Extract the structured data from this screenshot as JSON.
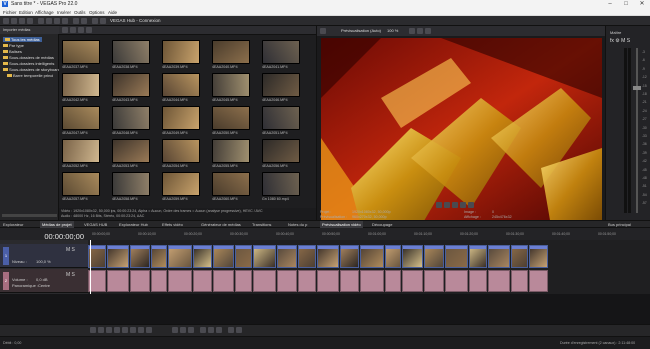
{
  "window": {
    "title": "Sans titre * - VEGAS Pro 22.0"
  },
  "menu": [
    "Fichier",
    "Edition",
    "Affichage",
    "Insérer",
    "Outils",
    "Options",
    "Aide"
  ],
  "toolbar": {
    "hub_connection": "VEGAS Hub - Connexion"
  },
  "explorer": {
    "import_label": "Importer médias",
    "tree": [
      "Tous les médias",
      "Par type",
      "Balises",
      "Sous-dossiers de médias",
      "Sous-dossiers intelligents",
      "Sous-dossiers de storyboard",
      "Barre temporelle princi"
    ]
  },
  "media": {
    "files": [
      "4EAA2037.MP4",
      "4EAA2038.MP4",
      "4EAA2039.MP4",
      "4EAA2040.MP4",
      "4EAA2041.MP4",
      "4EAA2042.MP4",
      "4EAA2043.MP4",
      "4EAA2044.MP4",
      "4EAA2045.MP4",
      "4EAA2046.MP4",
      "4EAA2047.MP4",
      "4EAA2048.MP4",
      "4EAA2049.MP4",
      "4EAA2050.MP4",
      "4EAA2051.MP4",
      "4EAA2052.MP4",
      "4EAA2053.MP4",
      "4EAA2054.MP4",
      "4EAA2055.MP4",
      "4EAA2056.MP4",
      "4EAA2057.MP4",
      "4EAA2058.MP4",
      "4EAA2059.MP4",
      "4EAA2060.MP4",
      "Gn 1080 60.mp4"
    ],
    "info_line1": "Vidéo : 1920x1080x32, 50,000 ips, 00:00:23:24, Alpha = Aucun, Ordre des trames = Aucun (analyse progressive), HEVC / AVC",
    "info_line2": "Audio : 48000 Hz, 16 Bits, Stéréo, 00:00:23:24, AAC"
  },
  "preview": {
    "mode": "Prévisualisation (Auto)",
    "zoom": "100 %",
    "project_label": "Projet :",
    "project_value": "1920x1080x32, 50,000p",
    "preview_label": "Prévisualisation :",
    "preview_value": "960x270x32, 50,000p",
    "image_label": "Image :",
    "image_value": "0",
    "display_label": "Affichage :",
    "display_value": "245x476x32",
    "tab": "Prévisualisation vidéo",
    "tab2": "Découpage"
  },
  "meter": {
    "title": "Maître",
    "scale": [
      "-3",
      "-6",
      "-9",
      "-12",
      "-15",
      "-18",
      "-21",
      "-24",
      "-27",
      "-30",
      "-33",
      "-36",
      "-39",
      "-42",
      "-45",
      "-48",
      "-51",
      "-54",
      "-57"
    ]
  },
  "tabs": [
    "Explorateur",
    "Médias de projet",
    "VEGAS HUB",
    "Explorateur Hub",
    "Effets vidéo",
    "Générateur de médias",
    "Transitions",
    "Notes du p"
  ],
  "bus_tab": "Bus principal",
  "timeline": {
    "timecode": "00:00:00;00",
    "ruler": [
      "00:00:00;00",
      "00:00:10;00",
      "00:00:20;00",
      "00:00:30;00",
      "00:00:40;00",
      "00:00:50;00",
      "00:01:00;00",
      "00:01:10;00",
      "00:01:20;00",
      "00:01:30;00",
      "00:01:40;00",
      "00:01:50;00"
    ],
    "video_track": {
      "num": "1",
      "level_label": "Niveau :",
      "level": "100,0 %"
    },
    "audio_track": {
      "num": "2",
      "vol_label": "Volume :",
      "vol": "0,0 dB",
      "pan_label": "Panoramique :",
      "pan": "Centre"
    }
  },
  "status": {
    "rate": "Débit : 0,00",
    "record": "Durée d'enregistrement (2 canaux) : 2:11:48:00"
  },
  "colors": {
    "accent": "#3d5f97",
    "clip_bar": "#6b7ed1",
    "audio_clip": "#b9899a",
    "folder": "#e3b84a"
  }
}
